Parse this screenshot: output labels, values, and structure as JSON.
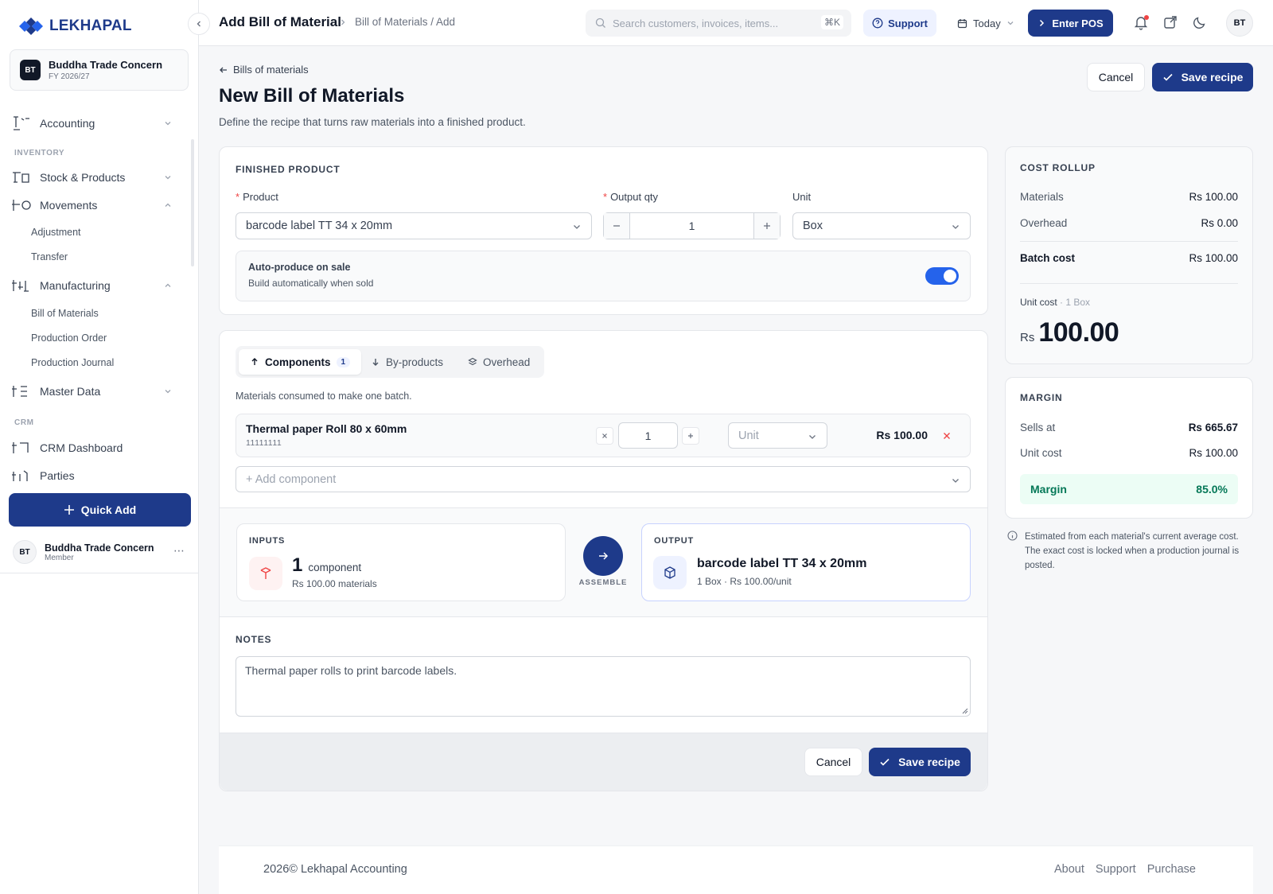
{
  "app": {
    "name": "LEKHAPAL",
    "org": {
      "initials": "BT",
      "name": "Buddha Trade Concern",
      "fy": "FY 2026/27"
    }
  },
  "sidebar": {
    "accounting": "Accounting",
    "sections": {
      "inventory": "INVENTORY",
      "crm": "CRM"
    },
    "stock": "Stock & Products",
    "movements": "Movements",
    "movements_sub": [
      "Adjustment",
      "Transfer"
    ],
    "manufacturing": "Manufacturing",
    "manufacturing_sub": [
      "Bill of Materials",
      "Production Order",
      "Production Journal"
    ],
    "master_data": "Master Data",
    "crm_dashboard": "CRM Dashboard",
    "parties": "Parties",
    "quick_add": "Quick Add",
    "user": {
      "initials": "BT",
      "name": "Buddha Trade Concern",
      "role": "Member",
      "more": "⋯"
    }
  },
  "header": {
    "title": "Add Bill of Material",
    "breadcrumb": "Bill of Materials / Add",
    "search_placeholder": "Search customers, invoices, items...",
    "search_shortcut": "⌘K",
    "support": "Support",
    "date": "Today",
    "enter_pos": "Enter POS",
    "avatar": "BT"
  },
  "page": {
    "back": "Bills of materials",
    "title": "New Bill of Materials",
    "subtitle": "Define the recipe that turns raw materials into a finished product.",
    "cancel": "Cancel",
    "save": "Save recipe"
  },
  "finished_product": {
    "section": "FINISHED PRODUCT",
    "product_label": "Product",
    "product_value": "barcode label TT 34 x 20mm",
    "qty_label": "Output qty",
    "qty_value": "1",
    "unit_label": "Unit",
    "unit_value": "Box",
    "auto_title": "Auto-produce on sale",
    "auto_desc": "Build automatically when sold",
    "auto_enabled": true
  },
  "components": {
    "tabs": {
      "components": "Components",
      "components_count": "1",
      "byproducts": "By-products",
      "overhead": "Overhead"
    },
    "hint": "Materials consumed to make one batch.",
    "rows": [
      {
        "name": "Thermal paper Roll 80 x 60mm",
        "code": "11111111",
        "qty": "1",
        "unit_placeholder": "Unit",
        "amount": "Rs 100.00"
      }
    ],
    "add_placeholder": "+ Add component"
  },
  "flow": {
    "inputs_label": "INPUTS",
    "inputs_count": "1",
    "inputs_unit": "component",
    "inputs_sub": "Rs 100.00 materials",
    "assemble": "ASSEMBLE",
    "output_label": "OUTPUT",
    "output_name": "barcode label TT 34 x 20mm",
    "output_sub": "1 Box · Rs 100.00/unit"
  },
  "notes": {
    "label": "NOTES",
    "value": "Thermal paper rolls to print barcode labels."
  },
  "footer_actions": {
    "cancel": "Cancel",
    "save": "Save recipe"
  },
  "cost_rollup": {
    "title": "COST ROLLUP",
    "materials_label": "Materials",
    "materials": "Rs 100.00",
    "overhead_label": "Overhead",
    "overhead": "Rs 0.00",
    "batch_label": "Batch cost",
    "batch": "Rs 100.00",
    "unit_label": "Unit cost",
    "unit_per": "· 1 Box",
    "unit_currency": "Rs",
    "unit_value": "100.00"
  },
  "margin": {
    "title": "MARGIN",
    "sells_label": "Sells at",
    "sells": "Rs 665.67",
    "unit_label": "Unit cost",
    "unit": "Rs 100.00",
    "margin_label": "Margin",
    "margin": "85.0%"
  },
  "info_note": "Estimated from each material's current average cost. The exact cost is locked when a production journal is posted.",
  "footer": {
    "copyright": "2026© Lekhapal Accounting",
    "links": [
      "About",
      "Support",
      "Purchase"
    ]
  },
  "colors": {
    "brand": "#1e3a8a",
    "toggle": "#2563eb",
    "danger": "#ef4444",
    "success_bg": "#ecfdf5",
    "success": "#047857"
  }
}
